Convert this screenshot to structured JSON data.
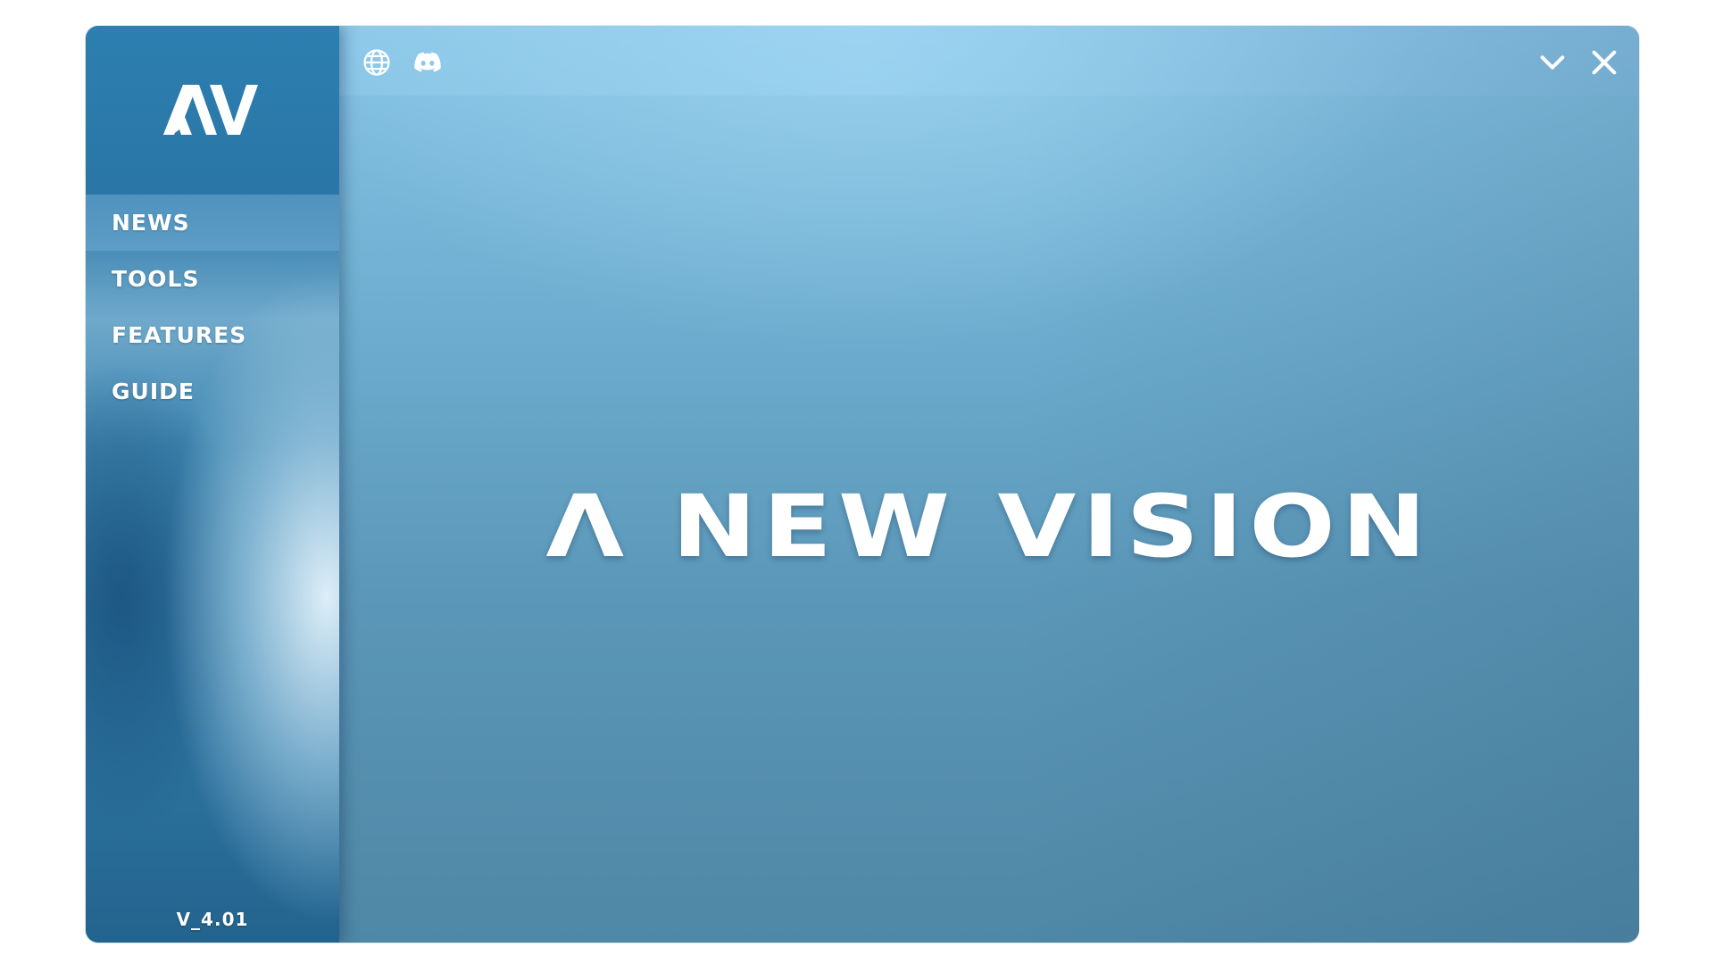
{
  "app": {
    "logo_text": "AV",
    "version": "V_4.01"
  },
  "topbar": {
    "left_icons": [
      "globe-icon",
      "discord-icon"
    ],
    "right_icons": [
      "chevron-down-icon",
      "close-icon"
    ]
  },
  "sidebar": {
    "items": [
      {
        "label": "NEWS",
        "active": true
      },
      {
        "label": "TOOLS",
        "active": false
      },
      {
        "label": "FEATURES",
        "active": false
      },
      {
        "label": "GUIDE",
        "active": false
      }
    ]
  },
  "main": {
    "headline": "Λ NEW VISION"
  },
  "colors": {
    "main_bg_top": "#86c4e6",
    "main_bg_bottom": "#4f87a6",
    "sidebar_blue": "#2a76a6",
    "text": "#ffffff"
  }
}
